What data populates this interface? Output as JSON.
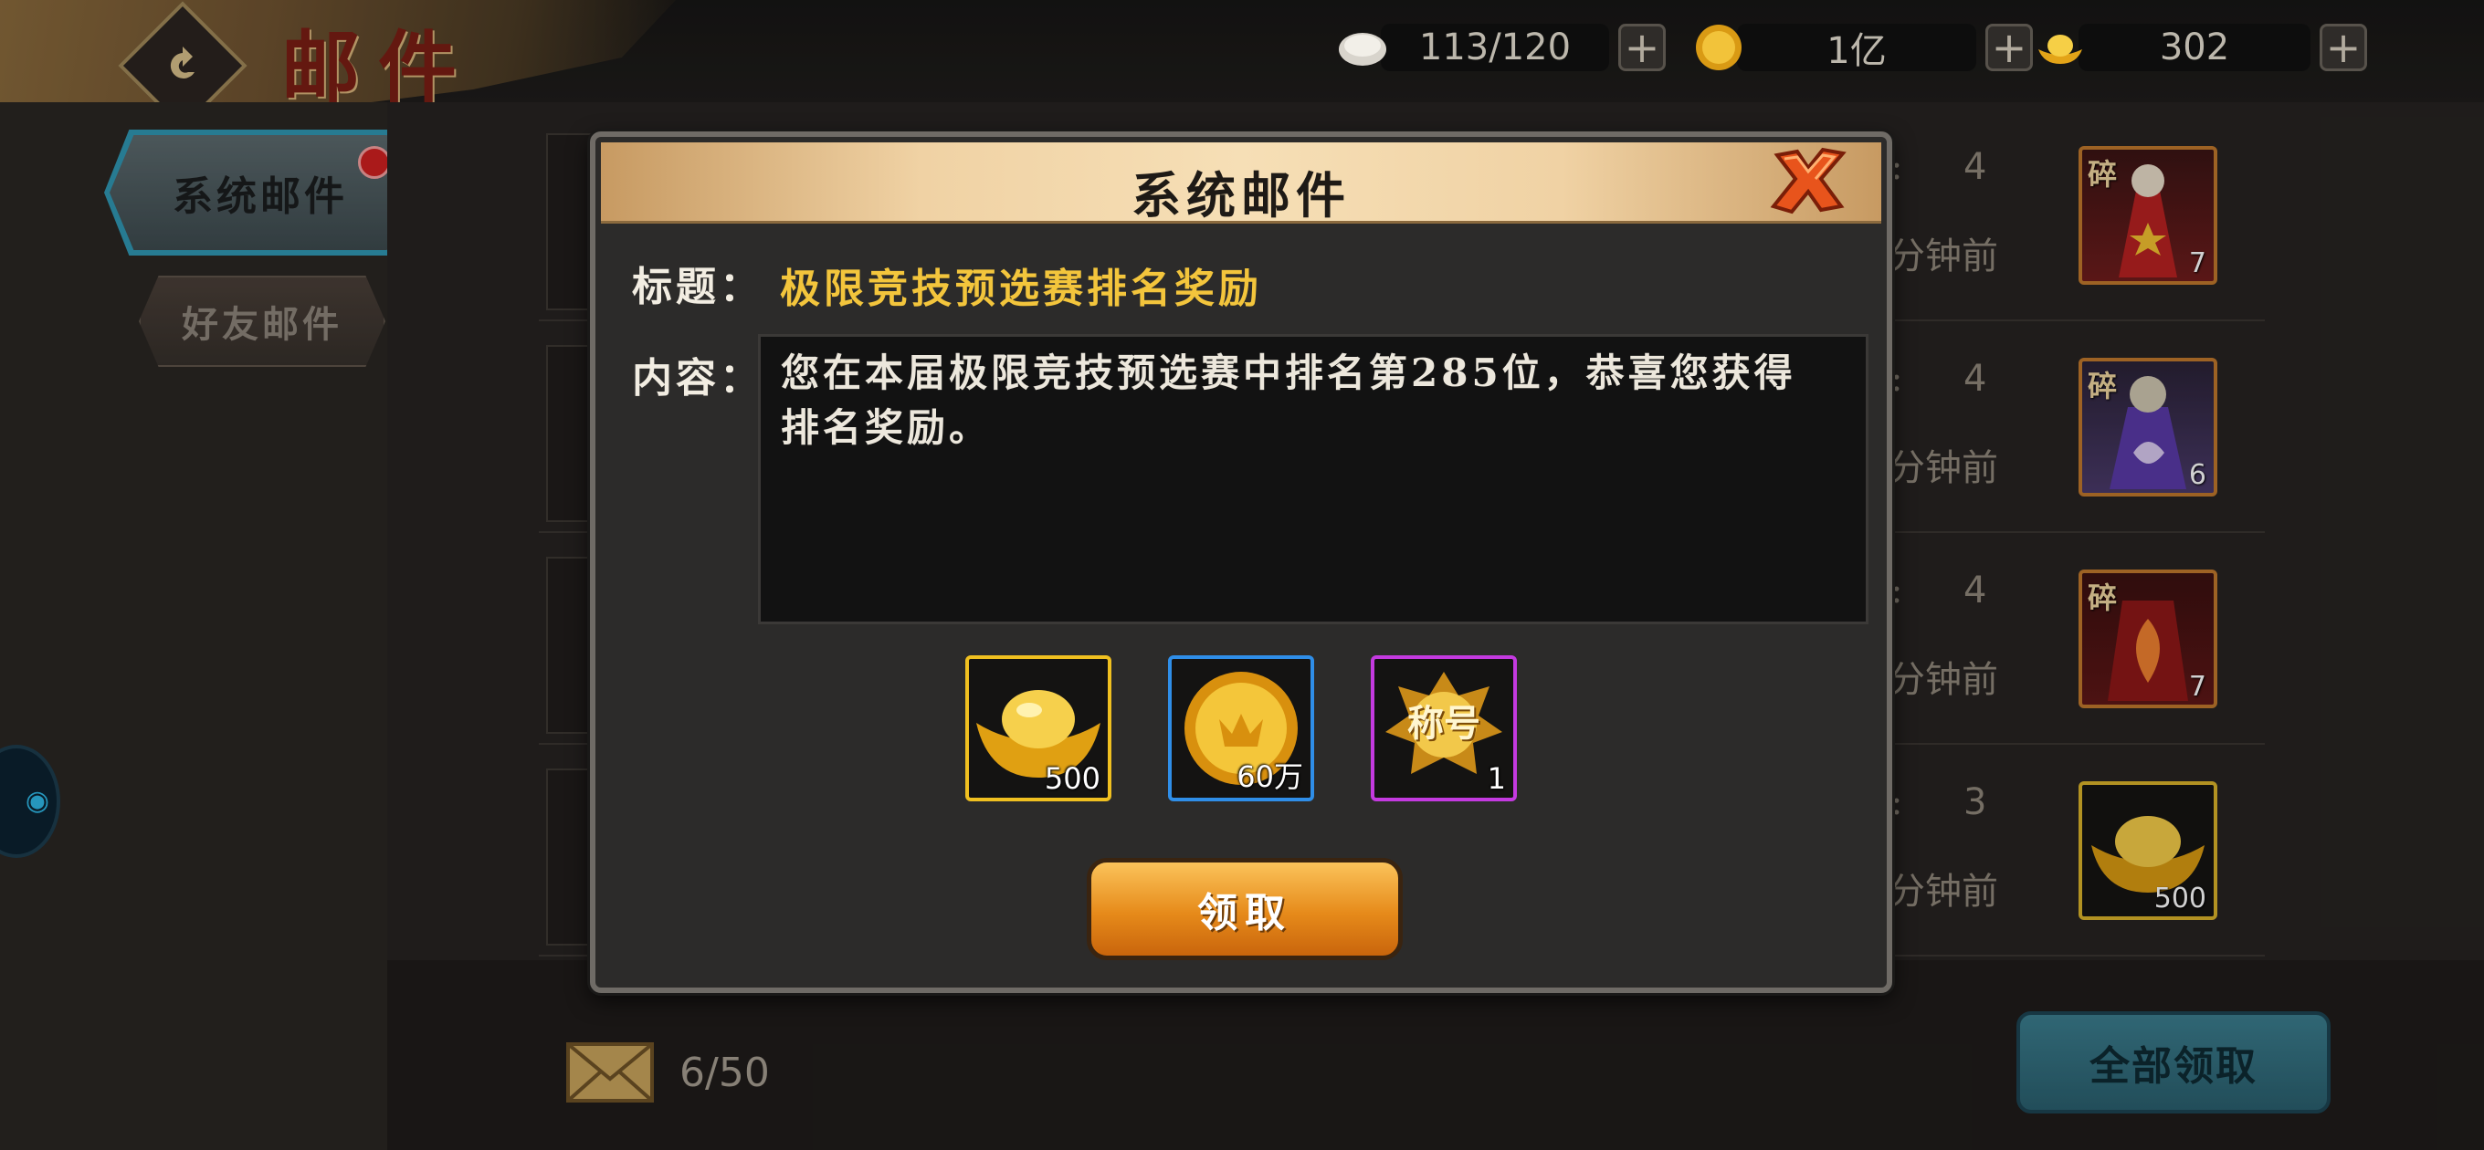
{
  "header": {
    "title": "邮件",
    "resources": [
      {
        "icon": "stamina-icon",
        "value": "113/120"
      },
      {
        "icon": "coin-icon",
        "value": "1亿"
      },
      {
        "icon": "gold-ingot-icon",
        "value": "302"
      }
    ]
  },
  "sidebar": {
    "tabs": [
      {
        "label": "系统邮件",
        "active": true,
        "has_notification": true
      },
      {
        "label": "好友邮件",
        "active": false
      }
    ]
  },
  "mail_list": {
    "rows": [
      {
        "count": "4",
        "time": "分钟前",
        "colon": ":",
        "reward_icon": "fragment-icon",
        "frag_label": "碎",
        "qty": "7",
        "border": "#c0782c"
      },
      {
        "count": "4",
        "time": "分钟前",
        "colon": ":",
        "reward_icon": "fragment-icon",
        "frag_label": "碎",
        "qty": "6",
        "border": "#c0782c"
      },
      {
        "count": "4",
        "time": "分钟前",
        "colon": ":",
        "reward_icon": "fragment-icon",
        "frag_label": "碎",
        "qty": "7",
        "border": "#c0782c"
      },
      {
        "count": "3",
        "time": "分钟前",
        "colon": ":",
        "reward_icon": "gold-ingot-icon",
        "frag_label": "",
        "qty": "500",
        "border": "#d9b22a"
      }
    ]
  },
  "footer": {
    "mail_count": "6/50",
    "claim_all_label": "全部领取"
  },
  "modal": {
    "title": "系统邮件",
    "subject_label": "标题：",
    "subject": "极限竞技预选赛排名奖励",
    "content_label": "内容：",
    "content": "您在本届极限竞技预选赛中排名第285位，恭喜您获得\n排名奖励。",
    "rewards": [
      {
        "icon": "gold-ingot-icon",
        "qty": "500",
        "border": "#f0c020"
      },
      {
        "icon": "coin-icon",
        "qty": "60万",
        "border": "#2f8ee8"
      },
      {
        "icon": "title-badge-icon",
        "qty": "1",
        "border": "#c43ae0",
        "badge_text": "称号"
      }
    ],
    "claim_label": "领取"
  }
}
